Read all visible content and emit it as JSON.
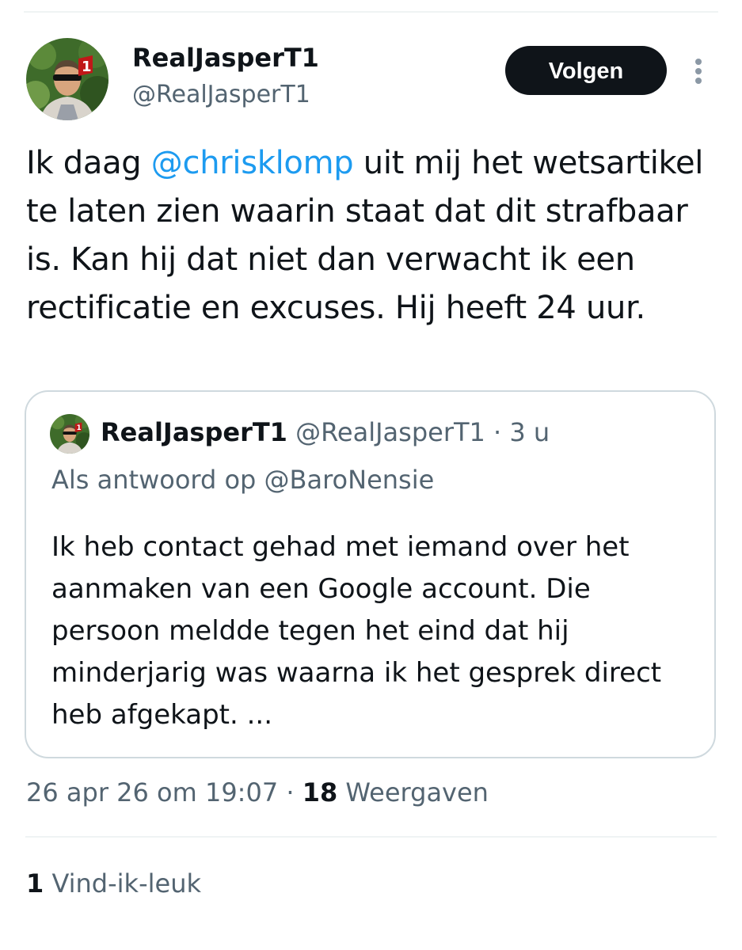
{
  "author": {
    "display_name": "RealJasperT1",
    "handle": "@RealJasperT1",
    "avatar_icon": "profile-photo"
  },
  "follow_button": {
    "label": "Volgen"
  },
  "more_icon": "vertical-dots-icon",
  "tweet": {
    "text_before": "Ik daag ",
    "mention": "@chrisklomp",
    "text_after": " uit mij het wetsartikel te laten zien waarin staat dat dit strafbaar is. Kan hij dat niet dan verwacht ik een rectificatie en excuses. Hij heeft 24 uur."
  },
  "quote": {
    "display_name": "RealJasperT1",
    "handle": "@RealJasperT1",
    "separator": " · ",
    "time": "3 u",
    "reply_to": "Als antwoord op @BaroNensie",
    "text": "Ik heb contact gehad met iemand over het aanmaken van een Google account. Die persoon meldde tegen het eind dat hij minderjarig was waarna ik het gesprek direct heb afgekapt. ..."
  },
  "meta": {
    "timestamp": "26 apr 26 om 19:07",
    "separator": " · ",
    "views_count": "18",
    "views_label": " Weergaven"
  },
  "likes": {
    "count": "1",
    "label": " Vind-ik-leuk"
  },
  "colors": {
    "text": "#0f1419",
    "secondary": "#536471",
    "link": "#1d9bf0",
    "divider": "#eff3f4",
    "card_border": "#cfd9de"
  }
}
